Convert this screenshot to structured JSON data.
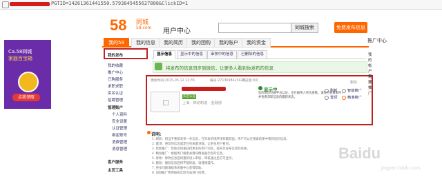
{
  "address_bar": {
    "url": "PGTID=14261361441550.5793845455627888&ClickID=1"
  },
  "header": {
    "logo_num": "58",
    "logo_sub": "同城",
    "logo_sub2": "58.com",
    "title": "用户中心",
    "search_btn": "同城搜索",
    "post_btn": "免费发布信息"
  },
  "nav": {
    "items": [
      "我的58",
      "我的信息",
      "我的简历",
      "我的团购",
      "我的账户",
      "我的资金"
    ],
    "promote": "推广中心"
  },
  "left_ad": {
    "line1": "Ca.58同城",
    "line2": "家庭百宝箱",
    "button": "点我领取"
  },
  "sidebar": {
    "items": [
      "我的发布",
      "我的收藏",
      "推广中心",
      "已购服务",
      "求职求职",
      "实名认证",
      "招聘管理",
      "管理账户",
      "个人资料",
      "安全设置",
      "认证管理",
      "绑定账号",
      "消费管理",
      "消息管理",
      "客户服务",
      "主页工具"
    ]
  },
  "tabs": [
    "显示信息",
    "显示中的信息",
    "审核中的信息",
    "已删除的信息"
  ],
  "banner": {
    "text": "将发布的信息同步到微信，让更多人看到你发布的信息"
  },
  "listing": {
    "updated": "更新时间:2015-03-12 12:35",
    "info_no": "编号:2713698423426",
    "views": "浏览量:0次",
    "verify": "实名认证",
    "price": "上海 - 棉纺制造 - 金融部",
    "category": "上海",
    "status": "显示中",
    "desc": "您的简历已被平台认证，正在被用人单位查看。请及时查看邮件，并查看求职信息的最新状态。",
    "actions": [
      "刷新",
      "置顶",
      "智能推广",
      "精准推广"
    ],
    "dismiss": "删除"
  },
  "right_panel": {
    "chars": [
      "我",
      "的",
      "帐",
      "户",
      "需",
      "要",
      "推",
      "广"
    ]
  },
  "help": {
    "title": "说明:",
    "lines": [
      "1. 刷新：相当于重新发布一条信息，在列表的排序排到最前面，用户可以在搜索结果中看到您的信息。",
      "2. 置顶：将您的信息固定在列表最顶端，让更多用户看到。",
      "3. 智能推广：帮助您快速获得更多的用户浏览，提升您发布信息的效果。",
      "4. 精准推广：根据用户搜索关键词精准展示您的信息。",
      "5. 修改：修改信息后将重新进入审核，审核通过后方可显示。",
      "6. 删除：删除信息后将不能恢复，请谨慎操作。",
      "7. 更多问题请联系客服中心获得帮助。",
      "8. 同城推广费用按照实际点击进行扣费。"
    ]
  },
  "watermark": {
    "brand": "Baidu",
    "sub": "jingyan.baidu.com"
  }
}
